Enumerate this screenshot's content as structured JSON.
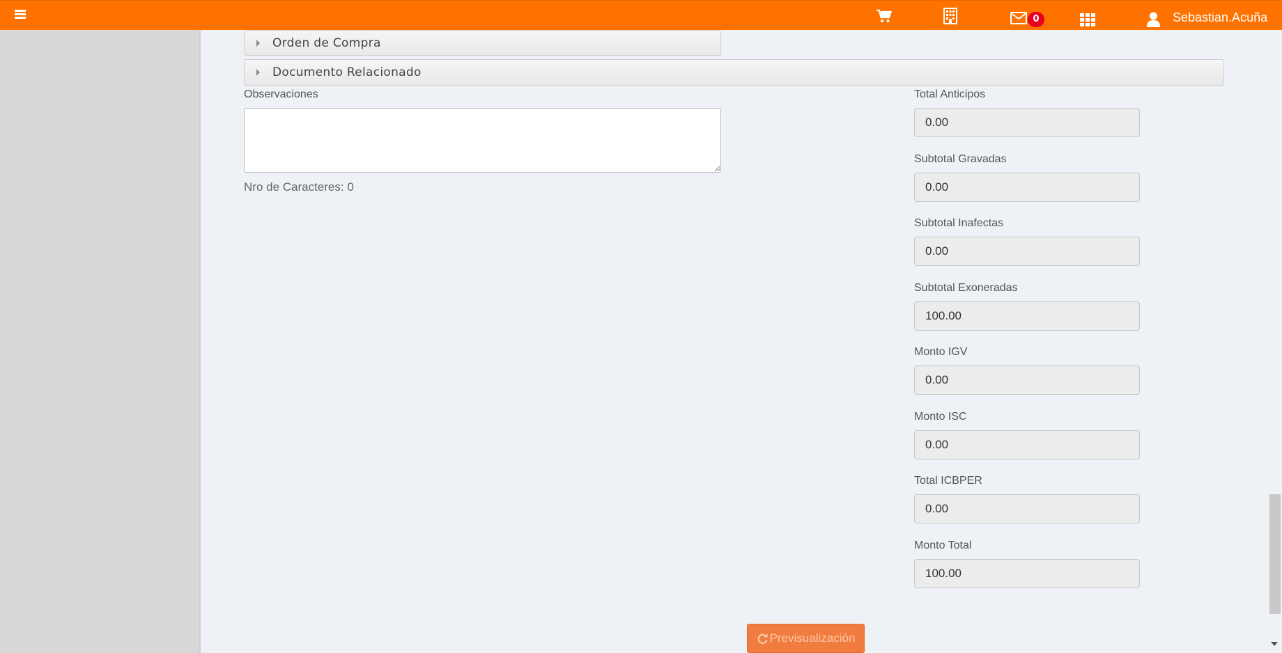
{
  "topbar": {
    "menu_icon": "hamburger-icon",
    "icons": [
      "cart-icon",
      "building-icon",
      "envelope-icon",
      "grid-icon",
      "user-icon"
    ],
    "mail_badge": "0",
    "username": "Sebastian.Acuña",
    "background": "#ff7200"
  },
  "panels": {
    "orden_compra": "Orden de Compra",
    "documento_relacionado": "Documento Relacionado"
  },
  "observaciones": {
    "label": "Observaciones",
    "value": "",
    "char_count": "Nro de Caracteres: 0"
  },
  "totals": {
    "total_anticipos": {
      "label": "Total Anticipos",
      "value": "0.00"
    },
    "subtotal_gravadas": {
      "label": "Subtotal Gravadas",
      "value": "0.00"
    },
    "subtotal_inafectas": {
      "label": "Subtotal Inafectas",
      "value": "0.00"
    },
    "subtotal_exoneradas": {
      "label": "Subtotal Exoneradas",
      "value": "100.00"
    },
    "monto_igv": {
      "label": "Monto IGV",
      "value": "0.00"
    },
    "monto_isc": {
      "label": "Monto ISC",
      "value": "0.00"
    },
    "total_icbper": {
      "label": "Total ICBPER",
      "value": "0.00"
    },
    "monto_total": {
      "label": "Monto Total",
      "value": "100.00"
    }
  },
  "actions": {
    "preview_label": "Previsualización",
    "preview_icon": "refresh-icon",
    "accent": "#f07d3f"
  }
}
